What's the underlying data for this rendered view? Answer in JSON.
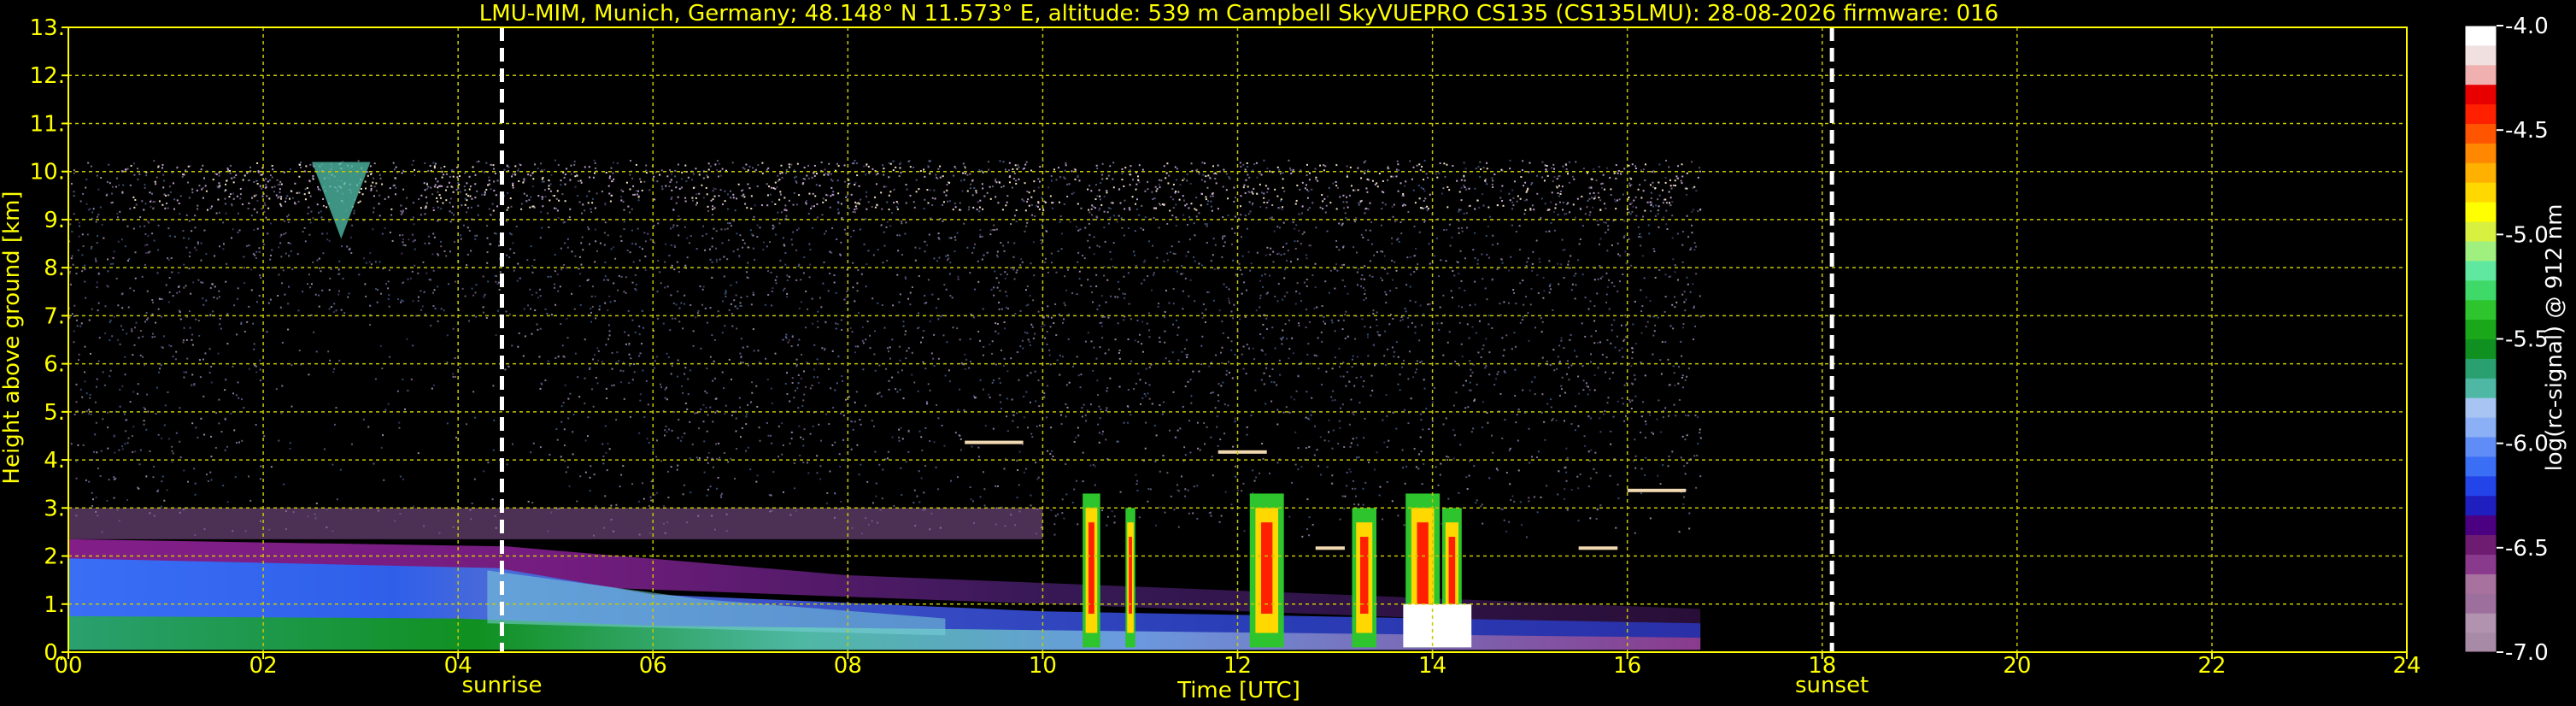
{
  "chart_data": {
    "type": "heatmap",
    "title": "LMU-MIM, Munich, Germany; 48.148° N 11.573° E, altitude: 539 m    Campbell SkyVUEPRO CS135 (CS135LMU): 28-08-2026    firmware: 016",
    "xlabel": "Time [UTC]",
    "ylabel": "Height above ground [km]",
    "xlim": [
      0,
      24
    ],
    "ylim": [
      0,
      13
    ],
    "x_ticks": [
      "00",
      "02",
      "04",
      "06",
      "08",
      "10",
      "12",
      "14",
      "16",
      "18",
      "20",
      "22",
      "24"
    ],
    "x_tick_values": [
      0,
      2,
      4,
      6,
      8,
      10,
      12,
      14,
      16,
      18,
      20,
      22,
      24
    ],
    "y_ticks": [
      "0.",
      "1.",
      "2.",
      "3.",
      "4.",
      "5.",
      "6.",
      "7.",
      "8.",
      "9.",
      "10.",
      "11.",
      "12.",
      "13."
    ],
    "y_tick_values": [
      0,
      1,
      2,
      3,
      4,
      5,
      6,
      7,
      8,
      9,
      10,
      11,
      12,
      13
    ],
    "grid": true,
    "data_end_time": 16.75,
    "data_top_height": 10.25,
    "markers": [
      {
        "label": "sunrise",
        "time": 4.45
      },
      {
        "label": "sunset",
        "time": 18.1
      }
    ],
    "colorbar": {
      "label": "log(rc-signal) @ 912 nm",
      "range": [
        -7.0,
        -4.0
      ],
      "ticks": [
        "-4.0",
        "-4.5",
        "-5.0",
        "-5.5",
        "-6.0",
        "-6.5",
        "-7.0"
      ],
      "tick_values": [
        -4.0,
        -4.5,
        -5.0,
        -5.5,
        -6.0,
        -6.5,
        -7.0
      ],
      "colors": [
        "#a78aa5",
        "#b192af",
        "#9c6f9c",
        "#a8729f",
        "#8a3a8c",
        "#6e1c72",
        "#4b0082",
        "#1f1fbf",
        "#2244e8",
        "#3a6ef5",
        "#5f8cf6",
        "#8cb0f5",
        "#a8c4f2",
        "#4fb8a4",
        "#2aa070",
        "#109020",
        "#1aa81a",
        "#2ec42e",
        "#3fd96a",
        "#60e8a0",
        "#a0f080",
        "#d8f040",
        "#ffff00",
        "#ffd800",
        "#ffb000",
        "#ff8800",
        "#ff5500",
        "#ff2000",
        "#e80000",
        "#f0b0b0",
        "#f0e0e0",
        "#ffffff"
      ]
    }
  }
}
